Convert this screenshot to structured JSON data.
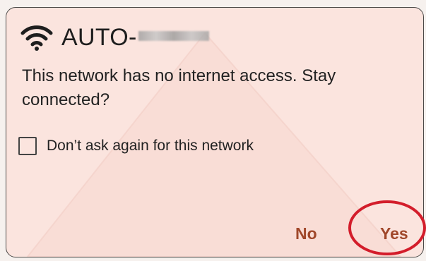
{
  "dialog": {
    "icon": "wifi-icon",
    "title": "AUTO-",
    "message": "This network has no internet access. Stay connected?",
    "checkbox": {
      "label": "Don’t ask again for this network",
      "checked": false
    },
    "buttons": {
      "no": "No",
      "yes": "Yes"
    },
    "accent_color": "#a0472a",
    "highlight_color": "#d31d2b"
  }
}
